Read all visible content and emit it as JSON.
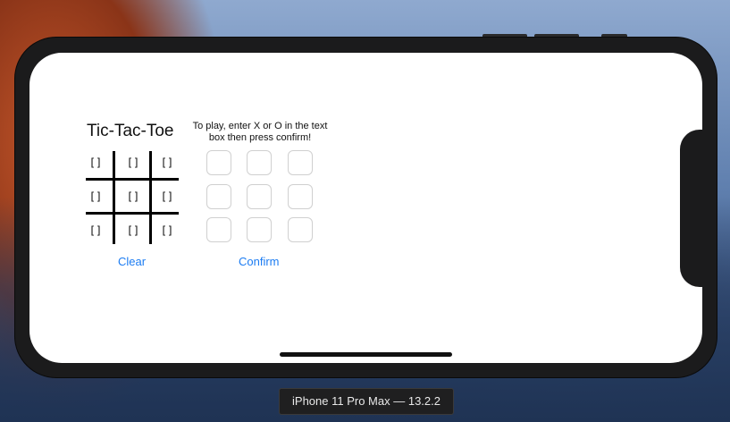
{
  "app": {
    "title": "Tic-Tac-Toe",
    "instructions": "To play, enter X or O in the text box then press confirm!"
  },
  "board": {
    "cells": [
      "[]",
      "[]",
      "[]",
      "[]",
      "[]",
      "[]",
      "[]",
      "[]",
      "[]"
    ]
  },
  "inputs": {
    "values": [
      "",
      "",
      "",
      "",
      "",
      "",
      "",
      "",
      ""
    ]
  },
  "actions": {
    "clear_label": "Clear",
    "confirm_label": "Confirm"
  },
  "simulator": {
    "device_label": "iPhone 11 Pro Max — 13.2.2"
  },
  "colors": {
    "link": "#1c7cf2",
    "device_frame": "#1b1b1c"
  }
}
